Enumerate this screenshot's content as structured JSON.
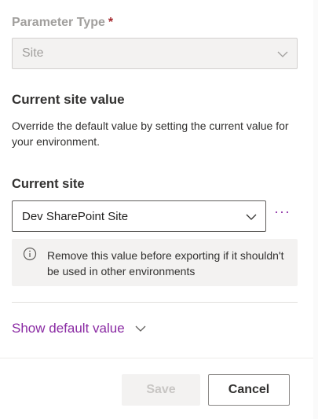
{
  "parameter_type": {
    "label": "Parameter Type",
    "required_marker": "*",
    "value": "Site",
    "icon": "chevron-down-icon"
  },
  "section": {
    "title": "Current site value",
    "description": "Override the default value by setting the current value for your environment."
  },
  "current_site": {
    "label": "Current site",
    "value": "Dev SharePoint Site",
    "more_label": "···",
    "icon": "chevron-down-icon"
  },
  "info": {
    "icon": "info-icon",
    "text": "Remove this value before exporting if it shouldn't be used in other environments"
  },
  "show_default": {
    "label": "Show default value",
    "icon": "chevron-down-icon"
  },
  "footer": {
    "save_label": "Save",
    "cancel_label": "Cancel"
  },
  "colors": {
    "accent": "#8a2aa3",
    "required": "#a4262c",
    "disabled_text": "#a19f9d"
  }
}
